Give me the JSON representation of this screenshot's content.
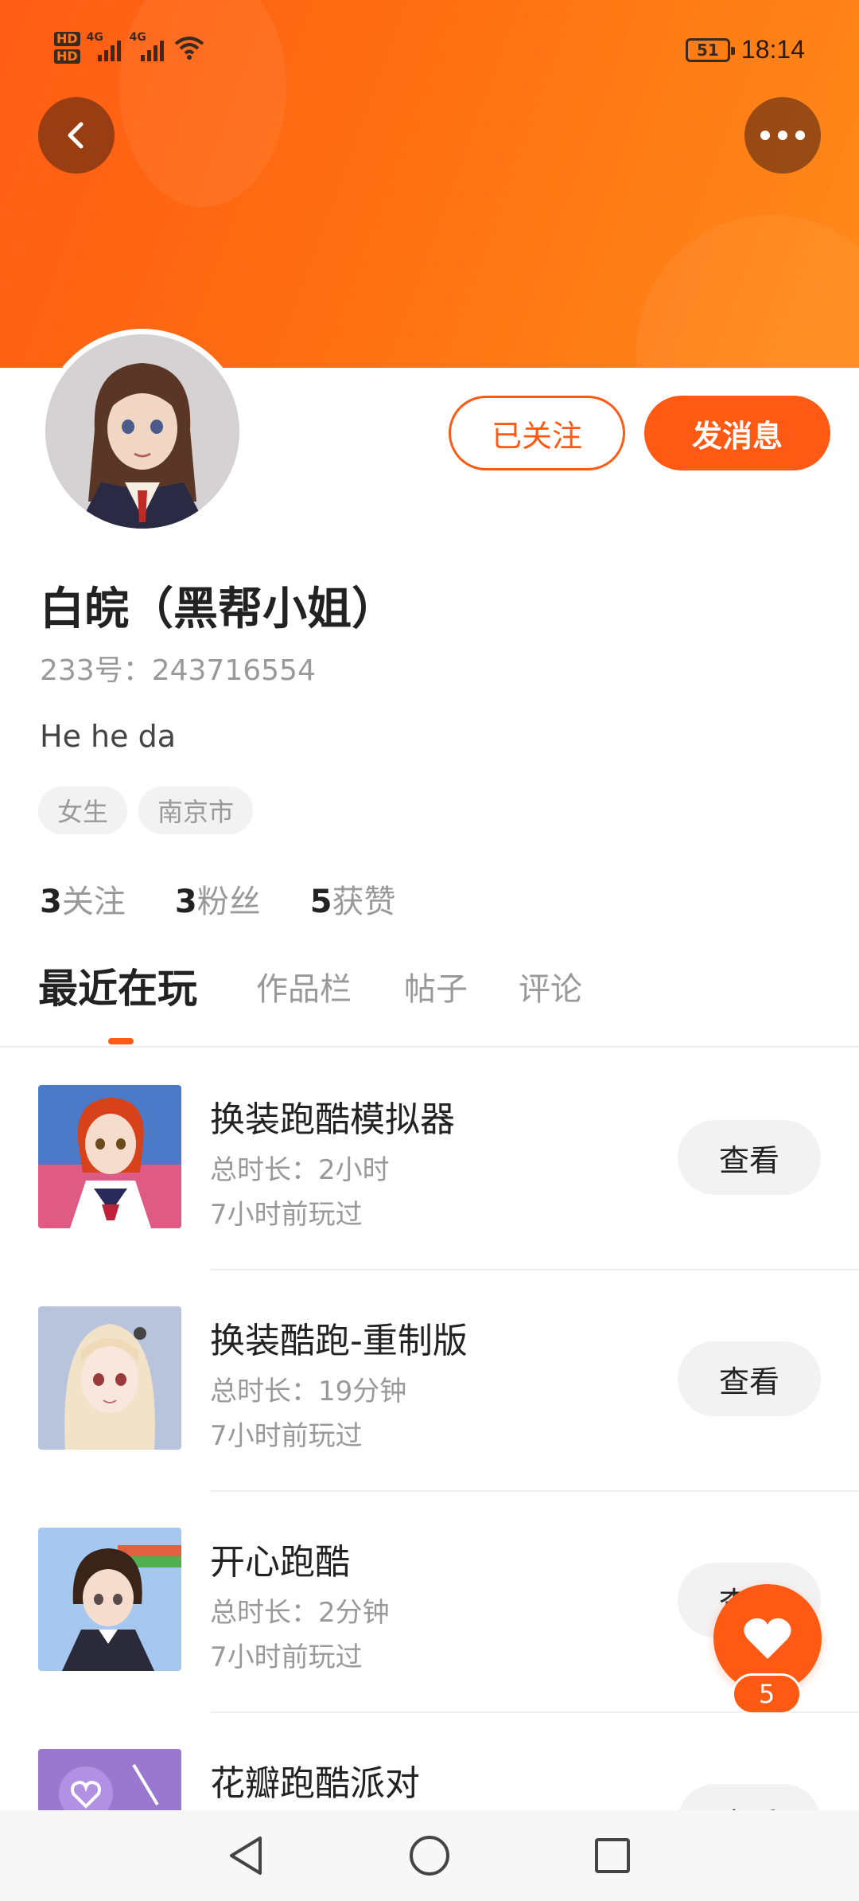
{
  "status_bar": {
    "hd1": "HD",
    "hd2": "HD",
    "net1": "4G",
    "net2": "4G",
    "battery": "51",
    "time": "18:14"
  },
  "profile": {
    "name": "白皖（黑帮小姐）",
    "uid": "233号：243716554",
    "bio": "He he da",
    "tags": [
      "女生",
      "南京市"
    ],
    "follow_label": "已关注",
    "message_label": "发消息"
  },
  "stats": [
    {
      "num": "3",
      "label": "关注"
    },
    {
      "num": "3",
      "label": "粉丝"
    },
    {
      "num": "5",
      "label": "获赞"
    }
  ],
  "tabs": [
    {
      "label": "最近在玩"
    },
    {
      "label": "作品栏"
    },
    {
      "label": "帖子"
    },
    {
      "label": "评论"
    }
  ],
  "games": [
    {
      "title": "换装跑酷模拟器",
      "duration": "总时长：2小时",
      "last_played": "7小时前玩过",
      "action": "查看"
    },
    {
      "title": "换装酷跑-重制版",
      "duration": "总时长：19分钟",
      "last_played": "7小时前玩过",
      "action": "查看"
    },
    {
      "title": "开心跑酷",
      "duration": "总时长：2分钟",
      "last_played": "7小时前玩过",
      "action": "查看"
    },
    {
      "title": "花瓣跑酷派对",
      "duration": "",
      "last_played": "",
      "action": "查看"
    }
  ],
  "like_fab": {
    "count": "5"
  },
  "colors": {
    "accent": "#ff5a14",
    "header_start": "#ff5c14",
    "header_end": "#ff8a1a"
  },
  "icons": {
    "back": "back-arrow-icon",
    "more": "more-dots-icon",
    "like": "heart-icon",
    "nav_back": "triangle-back-icon",
    "nav_home": "circle-home-icon",
    "nav_recents": "square-recents-icon"
  }
}
